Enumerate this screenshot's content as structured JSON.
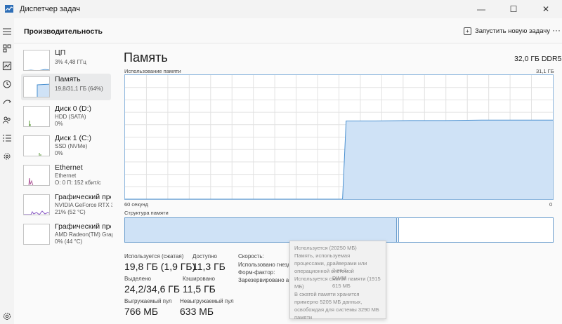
{
  "window": {
    "title": "Диспетчер задач",
    "controls": {
      "minimize": "—",
      "maximize": "☐",
      "close": "✕"
    }
  },
  "rail": {
    "icons": [
      "hamburger-icon",
      "processes-icon",
      "performance-icon",
      "history-icon",
      "startup-icon",
      "users-icon",
      "details-icon",
      "services-icon",
      "settings-icon"
    ]
  },
  "header": {
    "title": "Производительность",
    "run_task": "Запустить новую задачу",
    "more": "···"
  },
  "sidebar": {
    "items": [
      {
        "name": "ЦП",
        "sub1": "3% 4,48 ГГц",
        "sub2": ""
      },
      {
        "name": "Память",
        "sub1": "19,8/31,1 ГБ (64%)",
        "sub2": ""
      },
      {
        "name": "Диск 0 (D:)",
        "sub1": "HDD (SATA)",
        "sub2": "0%"
      },
      {
        "name": "Диск 1 (C:)",
        "sub1": "SSD (NVMe)",
        "sub2": "0%"
      },
      {
        "name": "Ethernet",
        "sub1": "Ethernet",
        "sub2": "О: 0 П: 152 кбит/с"
      },
      {
        "name": "Графический про",
        "sub1": "NVIDIA GeForce RTX 307",
        "sub2": "21% (52 °C)"
      },
      {
        "name": "Графический про",
        "sub1": "AMD Radeon(TM) Graph",
        "sub2": "0% (44 °C)"
      }
    ]
  },
  "main": {
    "title": "Память",
    "spec": "32,0 ГБ DDR5",
    "usage_label": "Использование памяти",
    "usage_max": "31,1 ГБ",
    "axis_left": "60 секунд",
    "axis_right": "0",
    "structure_label": "Структура памяти",
    "structure_used_fraction": 0.635
  },
  "chart_data": {
    "type": "area",
    "title": "Использование памяти",
    "xlabel": "",
    "ylabel": "",
    "x": [
      60,
      55,
      50,
      45,
      40,
      35,
      30,
      29.5,
      29,
      25,
      20,
      15,
      10,
      5,
      0
    ],
    "values": [
      0,
      0,
      0,
      0,
      0,
      0,
      0,
      0,
      19.6,
      19.6,
      19.7,
      19.7,
      19.8,
      19.8,
      19.8
    ],
    "xlim": [
      60,
      0
    ],
    "ylim": [
      0,
      31.1
    ],
    "grid": true,
    "colors": {
      "fill": "#cfe2f6",
      "stroke": "#4a90d0",
      "grid": "#e2e2e2"
    }
  },
  "stats": {
    "in_use_label": "Используется (сжатая)",
    "in_use_value": "19,8 ГБ (1,9 ГБ)",
    "available_label": "Доступно",
    "available_value": "11,3 ГБ",
    "committed_label": "Выделено",
    "committed_value": "24,2/34,6 ГБ",
    "cached_label": "Кэшировано",
    "cached_value": "11,5 ГБ",
    "paged_label": "Выгружаемый пул",
    "paged_value": "766 МБ",
    "nonpaged_label": "Невыгружаемый пул",
    "nonpaged_value": "633 МБ"
  },
  "details": {
    "speed_label": "Скорость:",
    "slots_label": "Использовано гнезд",
    "slots_value": "2 из 2",
    "form_label": "Форм-фактор:",
    "form_value": "DIMM",
    "reserved_label": "Зарезервировано ап",
    "reserved_value": "615 МБ"
  },
  "tooltip": {
    "line1": "Используется (20250 МБ)",
    "line2": "Память, используемая процессами, драйверами или операционной системой",
    "line3": "Используется сжатой памяти (1915 МБ)",
    "line4": "В сжатой памяти хранится примерно 5205 МБ данных, освобождая для системы 3290 МБ памяти"
  }
}
